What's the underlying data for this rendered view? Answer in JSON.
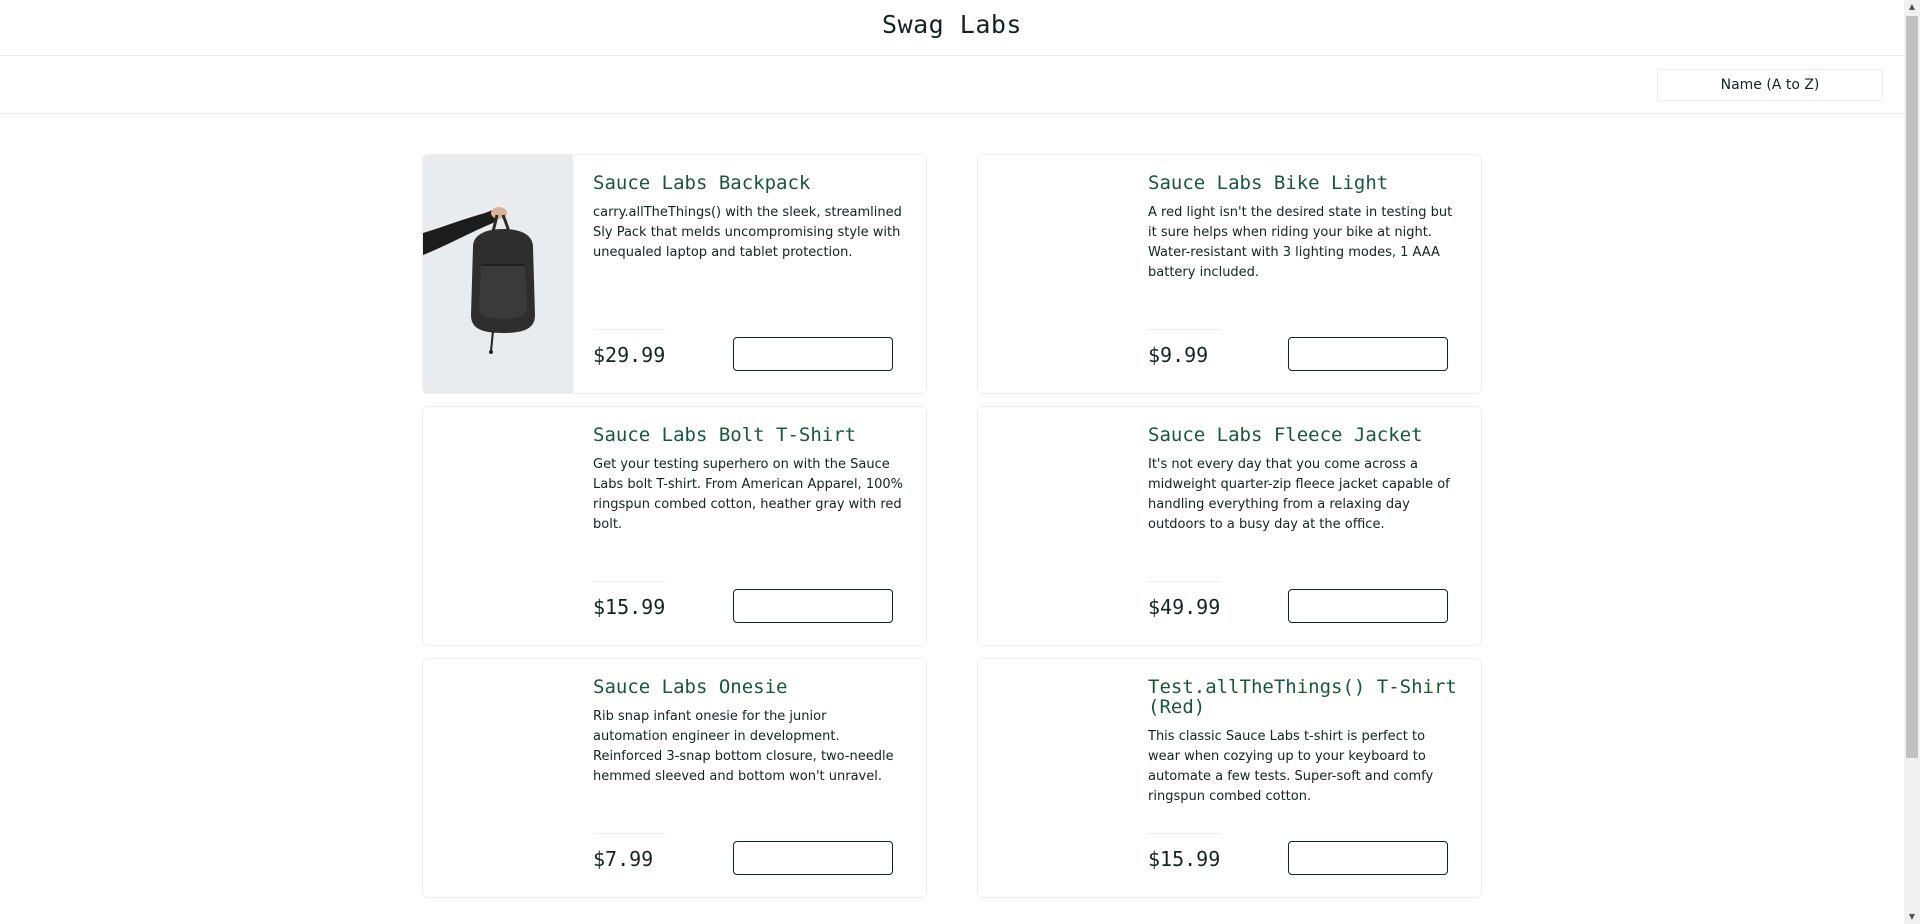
{
  "header": {
    "title": "Swag Labs"
  },
  "sort": {
    "selected": "Name (A to Z)"
  },
  "products": [
    {
      "name": "Sauce Labs Backpack",
      "description": "carry.allTheThings() with the sleek, streamlined Sly Pack that melds uncompromising style with unequaled laptop and tablet protection.",
      "price": "$29.99",
      "has_image": true
    },
    {
      "name": "Sauce Labs Bike Light",
      "description": "A red light isn't the desired state in testing but it sure helps when riding your bike at night. Water-resistant with 3 lighting modes, 1 AAA battery included.",
      "price": "$9.99",
      "has_image": false
    },
    {
      "name": "Sauce Labs Bolt T-Shirt",
      "description": "Get your testing superhero on with the Sauce Labs bolt T-shirt. From American Apparel, 100% ringspun combed cotton, heather gray with red bolt.",
      "price": "$15.99",
      "has_image": false
    },
    {
      "name": "Sauce Labs Fleece Jacket",
      "description": "It's not every day that you come across a midweight quarter-zip fleece jacket capable of handling everything from a relaxing day outdoors to a busy day at the office.",
      "price": "$49.99",
      "has_image": false
    },
    {
      "name": "Sauce Labs Onesie",
      "description": "Rib snap infant onesie for the junior automation engineer in development. Reinforced 3-snap bottom closure, two-needle hemmed sleeved and bottom won't unravel.",
      "price": "$7.99",
      "has_image": false
    },
    {
      "name": "Test.allTheThings() T-Shirt (Red)",
      "description": "This classic Sauce Labs t-shirt is perfect to wear when cozying up to your keyboard to automate a few tests. Super-soft and comfy ringspun combed cotton.",
      "price": "$15.99",
      "has_image": false
    }
  ],
  "colors": {
    "item_name": "#18583a",
    "text": "#132322",
    "border": "#ededed"
  },
  "icons": {
    "backpack_image": "backpack-photo"
  }
}
